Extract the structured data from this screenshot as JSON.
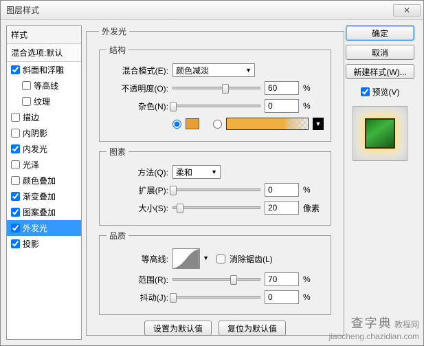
{
  "window": {
    "title": "图层样式"
  },
  "sidebar": {
    "header": "样式",
    "sub": "混合选项:默认",
    "items": [
      {
        "label": "斜面和浮雕",
        "checked": true,
        "indent": false
      },
      {
        "label": "等高线",
        "checked": false,
        "indent": true
      },
      {
        "label": "纹理",
        "checked": false,
        "indent": true
      },
      {
        "label": "描边",
        "checked": false,
        "indent": false
      },
      {
        "label": "内阴影",
        "checked": false,
        "indent": false
      },
      {
        "label": "内发光",
        "checked": true,
        "indent": false
      },
      {
        "label": "光泽",
        "checked": false,
        "indent": false
      },
      {
        "label": "颜色叠加",
        "checked": false,
        "indent": false
      },
      {
        "label": "渐变叠加",
        "checked": true,
        "indent": false
      },
      {
        "label": "图案叠加",
        "checked": true,
        "indent": false
      },
      {
        "label": "外发光",
        "checked": true,
        "indent": false,
        "selected": true
      },
      {
        "label": "投影",
        "checked": true,
        "indent": false
      }
    ]
  },
  "main": {
    "title": "外发光",
    "structure": {
      "legend": "结构",
      "blend_label": "混合模式(E):",
      "blend_value": "颜色减淡",
      "opacity_label": "不透明度(O):",
      "opacity_value": "60",
      "opacity_unit": "%",
      "noise_label": "杂色(N):",
      "noise_value": "0",
      "noise_unit": "%",
      "color_solid": "#e8a030"
    },
    "elements": {
      "legend": "图素",
      "technique_label": "方法(Q):",
      "technique_value": "柔和",
      "spread_label": "扩展(P):",
      "spread_value": "0",
      "spread_unit": "%",
      "size_label": "大小(S):",
      "size_value": "20",
      "size_unit": "像素"
    },
    "quality": {
      "legend": "品质",
      "contour_label": "等高线:",
      "antialias_label": "消除锯齿(L)",
      "range_label": "范围(R):",
      "range_value": "70",
      "range_unit": "%",
      "jitter_label": "抖动(J):",
      "jitter_value": "0",
      "jitter_unit": "%"
    },
    "reset_default": "设置为默认值",
    "revert_default": "复位为默认值"
  },
  "right": {
    "ok": "确定",
    "cancel": "取消",
    "new_style": "新建样式(W)...",
    "preview": "预览(V)"
  },
  "watermark": {
    "line1": "查字典",
    "line2": "教程网",
    "url": "jiaocheng.chazidian.com"
  }
}
